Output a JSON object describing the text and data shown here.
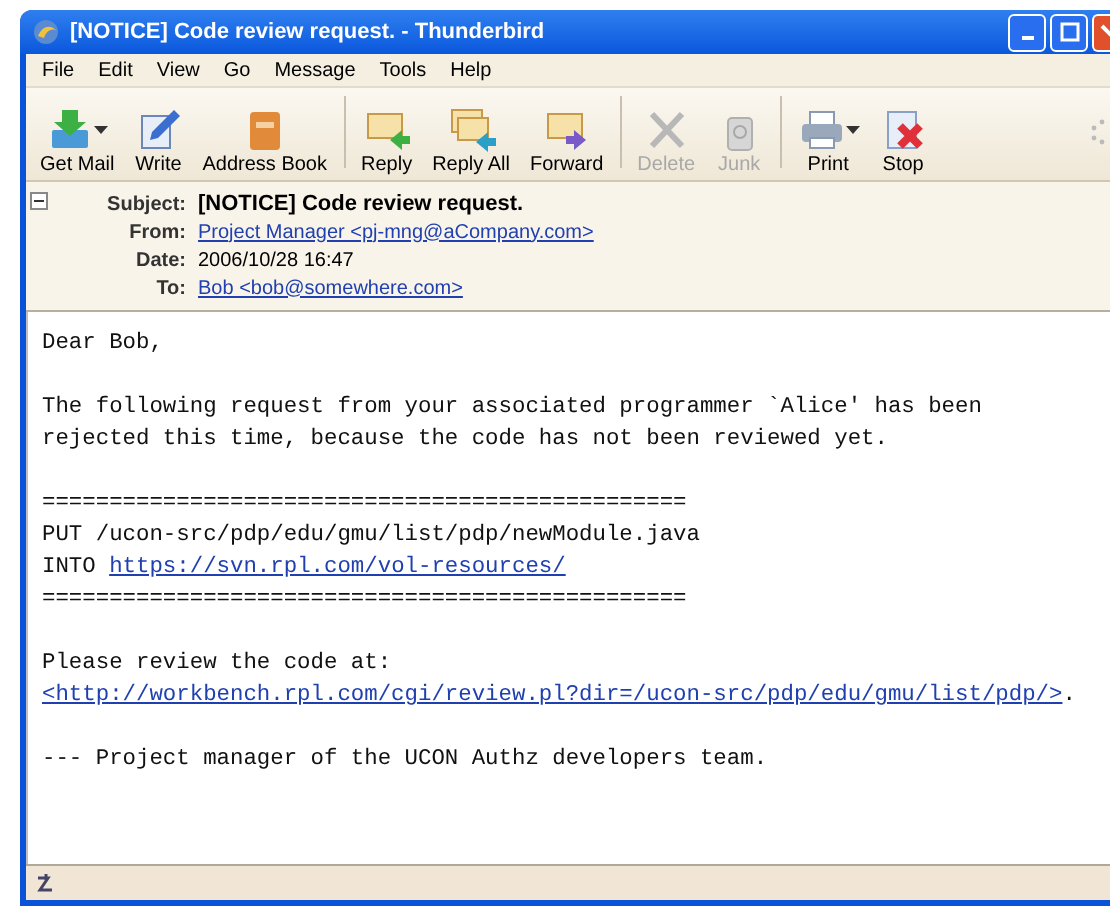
{
  "window": {
    "title": "[NOTICE] Code review request. - Thunderbird"
  },
  "menu": [
    "File",
    "Edit",
    "View",
    "Go",
    "Message",
    "Tools",
    "Help"
  ],
  "toolbar": [
    {
      "label": "Get Mail",
      "kind": "getmail",
      "dropdown": true,
      "disabled": false
    },
    {
      "label": "Write",
      "kind": "write",
      "dropdown": false,
      "disabled": false
    },
    {
      "label": "Address Book",
      "kind": "addressbook",
      "dropdown": false,
      "disabled": false
    },
    {
      "kind": "separator"
    },
    {
      "label": "Reply",
      "kind": "reply",
      "dropdown": false,
      "disabled": false
    },
    {
      "label": "Reply All",
      "kind": "replyall",
      "dropdown": false,
      "disabled": false
    },
    {
      "label": "Forward",
      "kind": "forward",
      "dropdown": false,
      "disabled": false
    },
    {
      "kind": "separator"
    },
    {
      "label": "Delete",
      "kind": "delete",
      "dropdown": false,
      "disabled": true
    },
    {
      "label": "Junk",
      "kind": "junk",
      "dropdown": false,
      "disabled": true
    },
    {
      "kind": "separator"
    },
    {
      "label": "Print",
      "kind": "print",
      "dropdown": true,
      "disabled": false
    },
    {
      "label": "Stop",
      "kind": "stop",
      "dropdown": false,
      "disabled": false
    }
  ],
  "header": {
    "expanded": true,
    "fields": [
      {
        "label": "Subject:",
        "value": "[NOTICE] Code review request.",
        "kind": "subject"
      },
      {
        "label": "From:",
        "value": "Project Manager <pj-mng@aCompany.com>",
        "kind": "link"
      },
      {
        "label": "Date:",
        "value": "2006/10/28 16:47",
        "kind": "text"
      },
      {
        "label": "To:",
        "value": "Bob <bob@somewhere.com>",
        "kind": "link"
      }
    ]
  },
  "body": {
    "paragraphs": [
      [
        {
          "text": "Dear Bob,"
        }
      ],
      [
        {
          "text": "The following request from your associated programmer `Alice' has been"
        },
        {
          "text": "rejected this time, because the code has not been reviewed yet."
        }
      ],
      [
        {
          "text": "================================================"
        },
        {
          "text": "PUT /ucon-src/pdp/edu/gmu/list/pdp/newModule.java"
        },
        {
          "text": "INTO ",
          "link": "https://svn.rpl.com/vol-resources/"
        },
        {
          "text": "================================================"
        }
      ],
      [
        {
          "text": "Please review the code at:"
        },
        {
          "link": "<http://workbench.rpl.com/cgi/review.pl?dir=/ucon-src/pdp/edu/gmu/list/pdp/>",
          "after": "."
        }
      ],
      [
        {
          "text": "--- Project manager of the UCON Authz developers team."
        }
      ]
    ]
  }
}
